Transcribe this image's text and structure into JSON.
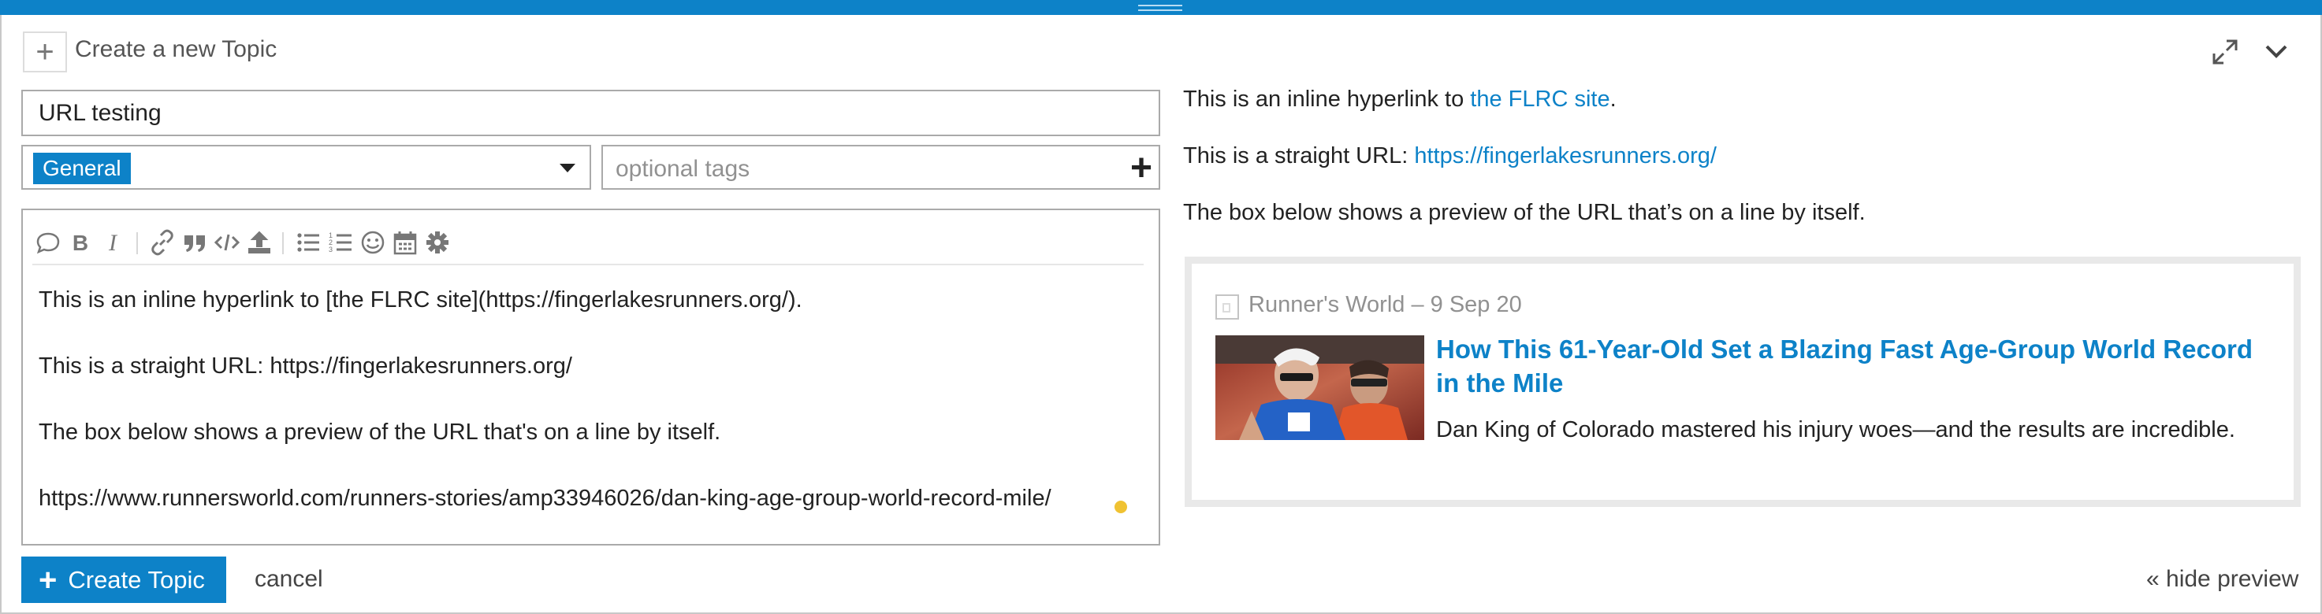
{
  "composer": {
    "action_title": "Create a new Topic",
    "title_value": "URL testing",
    "category": {
      "selected": "General",
      "badge_color": "#0d82c8"
    },
    "tags": {
      "placeholder": "optional tags"
    }
  },
  "toolbar": {
    "icons": [
      "quote-icon",
      "bold-icon",
      "italic-icon",
      "link-icon",
      "blockquote-icon",
      "code-icon",
      "upload-icon",
      "bullet-list-icon",
      "numbered-list-icon",
      "emoji-icon",
      "calendar-icon",
      "gear-icon"
    ]
  },
  "editor": {
    "lines": [
      "This is an inline hyperlink to [the FLRC site](https://fingerlakesrunners.org/).",
      "This is a straight URL: https://fingerlakesrunners.org/",
      "The box below shows a preview of the URL that's on a line by itself.",
      "https://www.runnersworld.com/runners-stories/amp33946026/dan-king-age-group-world-record-mile/"
    ]
  },
  "preview": {
    "line1_prefix": "This is an inline hyperlink to ",
    "line1_link": "the FLRC site",
    "line1_suffix": ".",
    "line2_prefix": "This is a straight URL: ",
    "line2_link": "https://fingerlakesrunners.org/",
    "line3": "The box below shows a preview of the URL that’s on a line by itself.",
    "onebox": {
      "source": "Runner's World – 9 Sep 20",
      "title": "How This 61-Year-Old Set a Blazing Fast Age-Group World Record in the Mile",
      "description": "Dan King of Colorado mastered his injury woes—and the results are incredible."
    }
  },
  "footer": {
    "create_label": "Create Topic",
    "cancel_label": "cancel",
    "hide_preview_label": "« hide preview"
  },
  "colors": {
    "accent": "#0d82c8",
    "caret_dot": "#f0c232"
  }
}
